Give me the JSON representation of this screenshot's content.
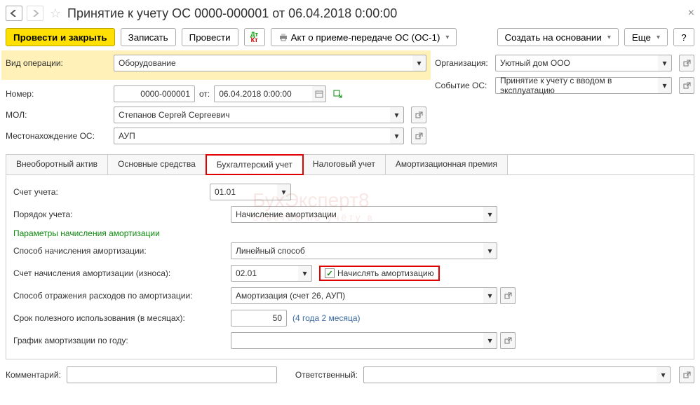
{
  "title": "Принятие к учету ОС 0000-000001 от 06.04.2018 0:00:00",
  "toolbar": {
    "post_close": "Провести и закрыть",
    "save": "Записать",
    "post": "Провести",
    "print_act": "Акт о приеме-передаче ОС (ОС-1)",
    "create_based": "Создать на основании",
    "more": "Еще",
    "help": "?"
  },
  "fields": {
    "operation_type_label": "Вид операции:",
    "operation_type_value": "Оборудование",
    "organization_label": "Организация:",
    "organization_value": "Уютный дом ООО",
    "number_label": "Номер:",
    "number_value": "0000-000001",
    "date_label": "от:",
    "date_value": "06.04.2018  0:00:00",
    "event_label": "Событие ОС:",
    "event_value": "Принятие к учету с вводом в эксплуатацию",
    "mol_label": "МОЛ:",
    "mol_value": "Степанов Сергей Сергеевич",
    "location_label": "Местонахождение ОС:",
    "location_value": "АУП"
  },
  "tabs": {
    "t1": "Внеоборотный актив",
    "t2": "Основные средства",
    "t3": "Бухгалтерский учет",
    "t4": "Налоговый учет",
    "t5": "Амортизационная премия"
  },
  "content": {
    "account_label": "Счет учета:",
    "account_value": "01.01",
    "order_label": "Порядок учета:",
    "order_value": "Начисление амортизации",
    "section_title": "Параметры начисления амортизации",
    "method_label": "Способ начисления амортизации:",
    "method_value": "Линейный способ",
    "depr_account_label": "Счет начисления амортизации (износа):",
    "depr_account_value": "02.01",
    "charge_checkbox_label": "Начислять амортизацию",
    "expense_label": "Способ отражения расходов по амортизации:",
    "expense_value": "Амортизация (счет 26, АУП)",
    "useful_life_label": "Срок полезного использования (в месяцах):",
    "useful_life_value": "50",
    "useful_life_hint": "(4 года 2 месяца)",
    "schedule_label": "График амортизации по году:"
  },
  "footer": {
    "comment_label": "Комментарий:",
    "responsible_label": "Ответственный:"
  },
  "watermark": {
    "line1": "БухЭксперт8",
    "line2": "ответов по учёту в"
  }
}
